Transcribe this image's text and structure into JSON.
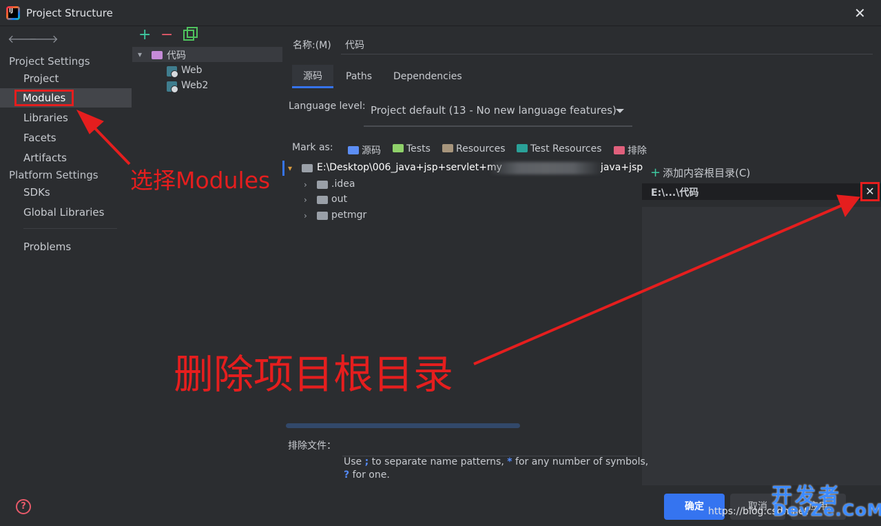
{
  "window": {
    "title": "Project Structure",
    "close_glyph": "✕"
  },
  "nav": {
    "back_glyph": "🡐",
    "forward_glyph": "🡒",
    "project_settings_header": "Project Settings",
    "project_settings_items": [
      "Project",
      "Modules",
      "Libraries",
      "Facets",
      "Artifacts"
    ],
    "platform_settings_header": "Platform Settings",
    "platform_settings_items": [
      "SDKs",
      "Global Libraries"
    ],
    "problems": "Problems",
    "selected": "Modules"
  },
  "module_tree": {
    "add_glyph": "+",
    "remove_glyph": "−",
    "root": "代码",
    "children": [
      "Web",
      "Web2"
    ]
  },
  "module": {
    "name_label": "名称:(M)",
    "name_value": "代码",
    "tabs": [
      "源码",
      "Paths",
      "Dependencies"
    ],
    "active_tab": "源码",
    "language_level_label": "Language level:",
    "language_level_value": "Project default (13 - No new language features)",
    "mark_as_label": "Mark as:",
    "mark_as": [
      {
        "label": "源码",
        "color": "#5c8ef5"
      },
      {
        "label": "Tests",
        "color": "#8fd16a"
      },
      {
        "label": "Resources",
        "color": "#a7957c"
      },
      {
        "label": "Test Resources",
        "color": "#2aa198"
      },
      {
        "label": "排除",
        "color": "#e0607c"
      }
    ]
  },
  "content_tree": {
    "root_path": "E:\\Desktop\\006_java+jsp+servlet+my",
    "root_path_tail": "java+jsp",
    "folders": [
      ".idea",
      "out",
      "petmgr"
    ]
  },
  "content_root_panel": {
    "add_label": "添加内容根目录(C)",
    "root_entry": "E:\\...\\代码",
    "remove_glyph": "✕"
  },
  "exclude": {
    "label": "排除文件：",
    "hint_line1_a": "Use",
    "hint_line1_semicolon": ";",
    "hint_line1_b": "to separate name patterns,",
    "hint_line1_star": "*",
    "hint_line1_c": "for any number of symbols,",
    "hint_line2_q": "?",
    "hint_line2_b": "for one."
  },
  "buttons": {
    "ok": "确定",
    "cancel": "取消",
    "apply": "应用"
  },
  "annotations": {
    "select_modules": "选择Modules",
    "delete_root": "删除项目根目录"
  },
  "watermark": {
    "url": "https://blog.csdn.net",
    "cn": "开发者",
    "en": "DevZe.CoM"
  },
  "help_glyph": "?"
}
